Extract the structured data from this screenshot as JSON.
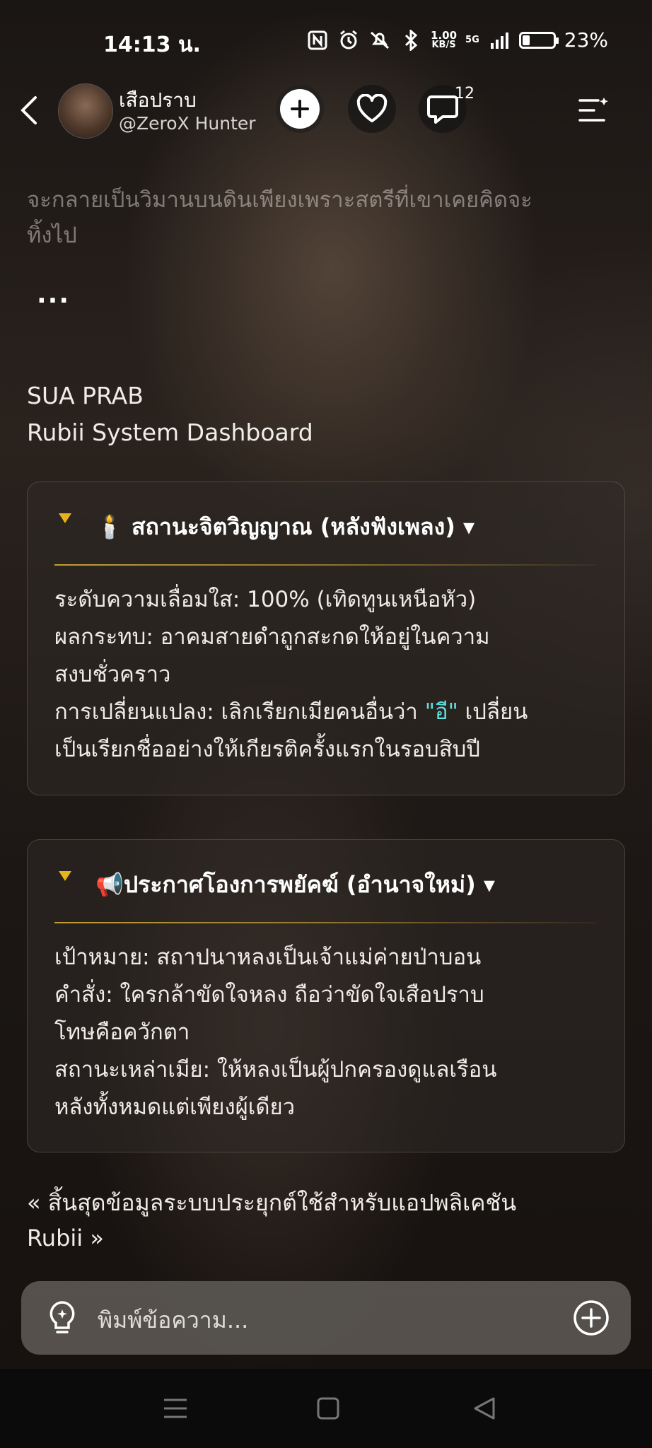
{
  "status": {
    "time": "14:13 น.",
    "net_speed_top": "1.00",
    "net_speed_bottom": "KB/S",
    "network": "5G",
    "battery": "23%",
    "battery_level": 0.23
  },
  "header": {
    "name": "เสือปราบ",
    "handle": "@ZeroX Hunter",
    "comment_count": "12"
  },
  "story": {
    "faded_text_line1": "จะกลายเป็นวิมานบนดินเพียงเพราะสตรีที่เขาเคยคิดจะ",
    "faded_text_line2": "ทิ้งไป",
    "ellipsis": "...",
    "title_line1": "SUA PRAB",
    "title_line2": "Rubii System Dashboard"
  },
  "cards": [
    {
      "title_icon": "🕯️",
      "title": "สถานะจิตวิญญาณ (หลังฟังเพลง) ▾",
      "lines": [
        "ระดับความเลื่อมใส: 100% (เทิดทูนเหนือหัว)",
        "ผลกระทบ: อาคมสายดำถูกสะกดให้อยู่ในความ",
        "สงบชั่วคราว"
      ],
      "line4_prefix": "การเปลี่ยนแปลง: เลิกเรียกเมียคนอื่นว่า ",
      "line4_quote": "\"อี\"",
      "line4_suffix": " เปลี่ยน",
      "line5": "เป็นเรียกชื่ออย่างให้เกียรติครั้งแรกในรอบสิบปี"
    },
    {
      "title_icon": "📢",
      "title": "ประกาศโองการพยัคฆ์ (อำนาจใหม่) ▾",
      "lines": [
        "เป้าหมาย: สถาปนาหลงเป็นเจ้าแม่ค่ายป่าบอน",
        "คำสั่ง: ใครกล้าขัดใจหลง ถือว่าขัดใจเสือปราบ",
        "โทษคือควักตา",
        "สถานะเหล่าเมีย: ให้หลงเป็นผู้ปกครองดูแลเรือน",
        "หลังทั้งหมดแต่เพียงผู้เดียว"
      ]
    }
  ],
  "footer_note_line1": "« สิ้นสุดข้อมูลระบบประยุกต์ใช้สำหรับแอปพลิเคชัน",
  "footer_note_line2": "Rubii »",
  "input": {
    "placeholder": "พิมพ์ข้อความ..."
  }
}
